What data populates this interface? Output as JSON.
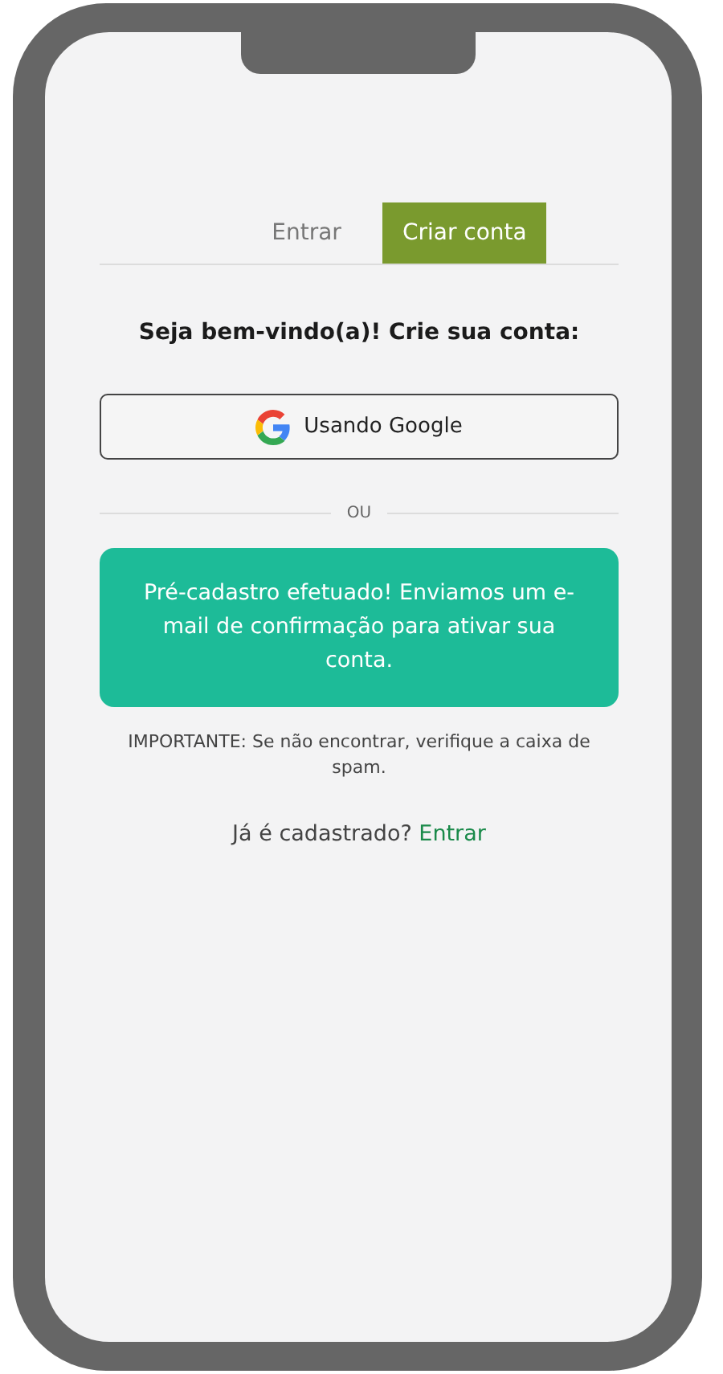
{
  "tabs": [
    {
      "label": "Entrar",
      "selected": false
    },
    {
      "label": "Criar conta",
      "selected": true
    }
  ],
  "heading": "Seja bem-vindo(a)! Crie sua conta:",
  "google_button": {
    "label": "Usando Google"
  },
  "divider_label": "OU",
  "alert": {
    "message": "Pré-cadastro efetuado! Enviamos um e-mail de confirmação para ativar sua conta."
  },
  "note": "IMPORTANTE: Se não encontrar, verifique a caixa de spam.",
  "footer": {
    "text": "Já é cadastrado?",
    "link": "Entrar"
  }
}
